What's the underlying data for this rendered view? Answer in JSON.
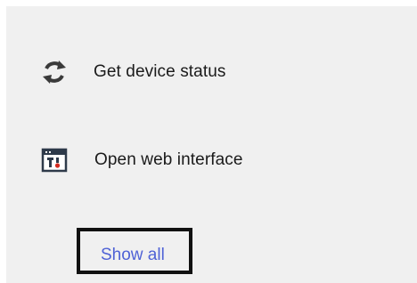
{
  "actions": [
    {
      "label": "Get device status",
      "icon": "refresh-icon"
    },
    {
      "label": "Open web interface",
      "icon": "web-interface-icon"
    }
  ],
  "show_all": {
    "label": "Show all"
  },
  "colors": {
    "panel_bg": "#f0f0f0",
    "link": "#4f62d6",
    "text": "#1a1a1a",
    "highlight_border": "#111111"
  }
}
